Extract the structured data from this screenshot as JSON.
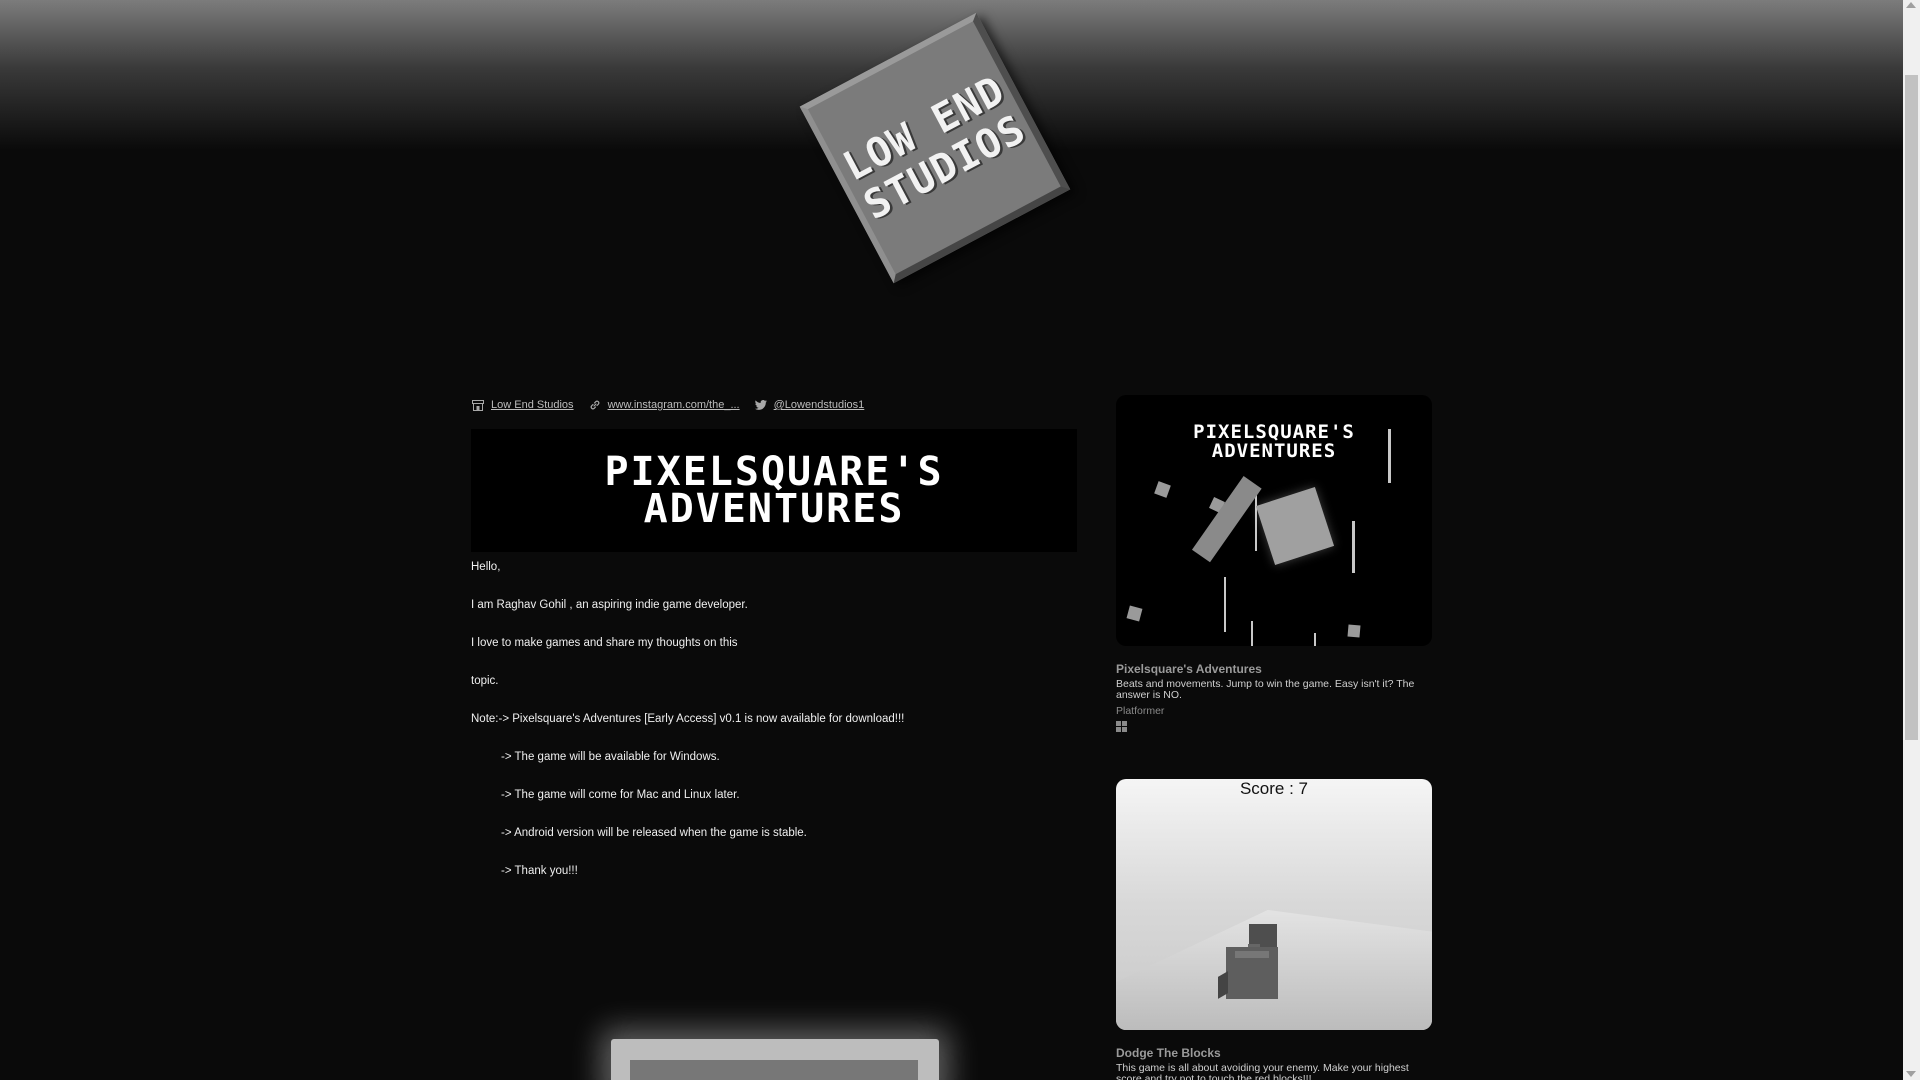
{
  "logo": {
    "text": "LOW END\nSTUDIOS"
  },
  "links": [
    {
      "icon": "storefront-icon",
      "label": "Low End Studios"
    },
    {
      "icon": "link-icon",
      "label": "www.instagram.com/the_..."
    },
    {
      "icon": "twitter-icon",
      "label": "@Lowendstudios1"
    }
  ],
  "banner": {
    "title": "PIXELSQUARE'S\nADVENTURES"
  },
  "body": {
    "lines": [
      "Hello,",
      "I am Raghav Gohil , an aspiring indie game developer.",
      "I love to make games and share my thoughts on this",
      "topic.",
      "Note:-> Pixelsquare's Adventures [Early Access] v0.1 is now available for download!!!",
      "-> The game will be available for Windows.",
      "-> The game will come for Mac and Linux later.",
      "-> Android version will be released when the game is stable.",
      "-> Thank you!!!"
    ]
  },
  "games": [
    {
      "thumb_title": "PIXELSQUARE'S\nADVENTURES",
      "title": "Pixelsquare's Adventures",
      "description": "Beats and movements. Jump to win the game. Easy isn't it? The answer is NO.",
      "genre": "Platformer",
      "platform_icon": "windows-icon"
    },
    {
      "thumb_score": "Score : 7",
      "title": "Dodge The Blocks",
      "description": "This game is all about avoiding your enemy. Make your highest score and try not to touch the red blocks!!!"
    }
  ]
}
